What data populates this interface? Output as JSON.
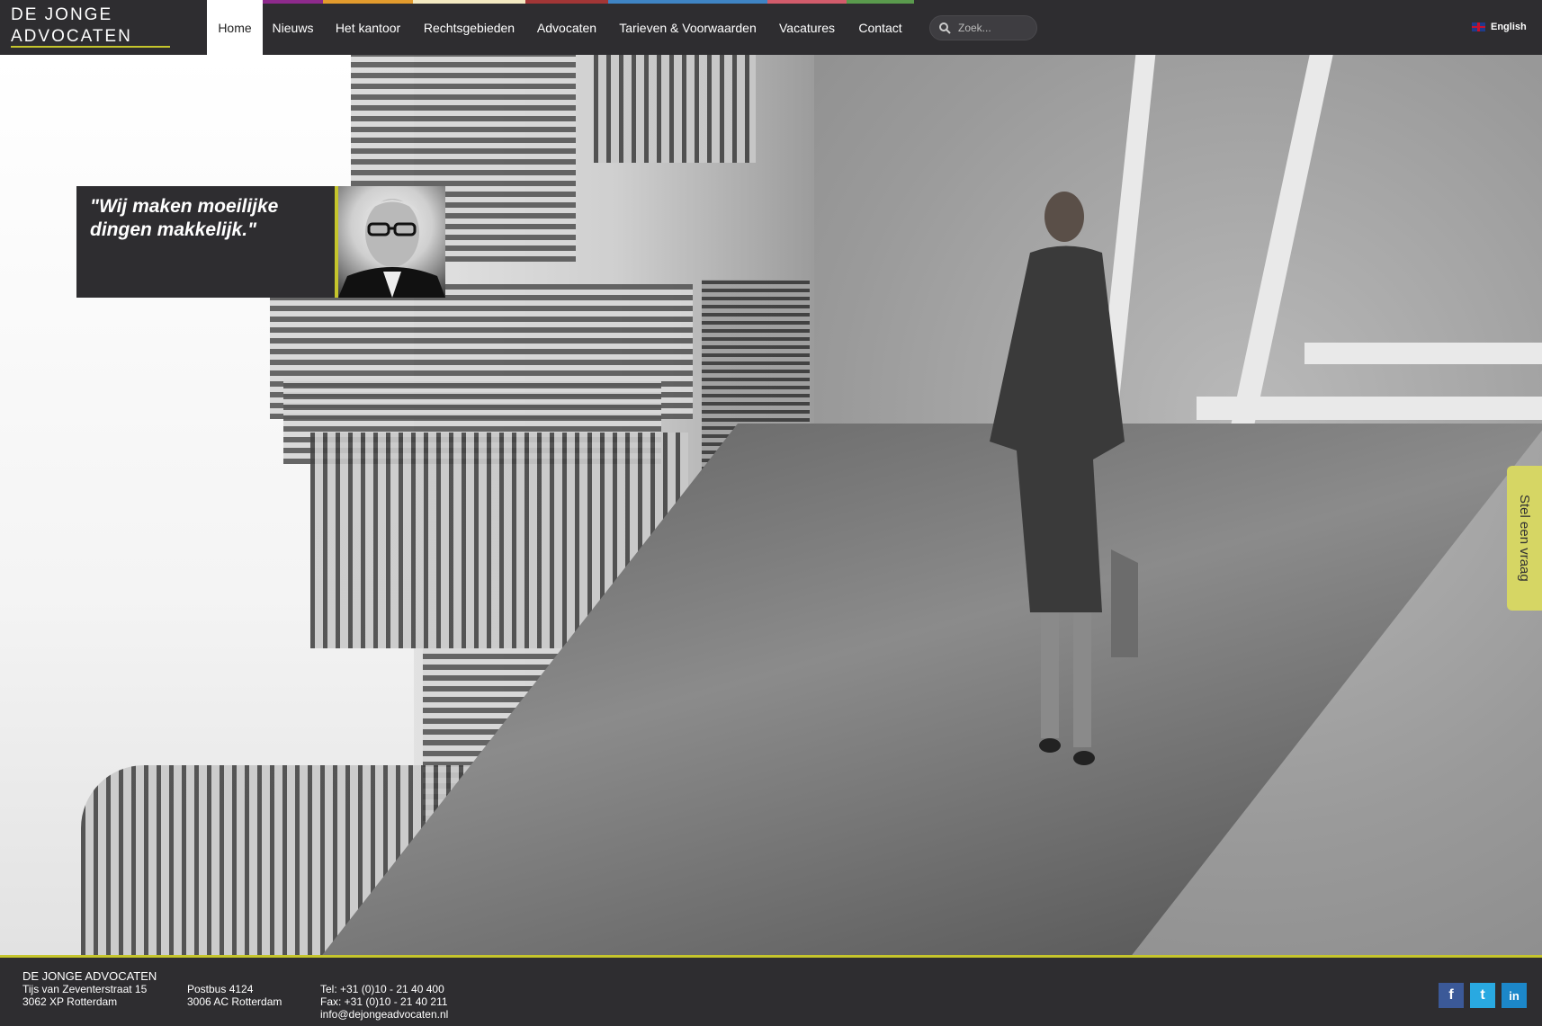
{
  "logo": {
    "line1": "DE JONGE",
    "line2": "ADVOCATEN"
  },
  "nav": [
    {
      "label": "Home",
      "color": "#ffffff"
    },
    {
      "label": "Nieuws",
      "color": "#8e2a8c"
    },
    {
      "label": "Het kantoor",
      "color": "#e39b2d"
    },
    {
      "label": "Rechtsgebieden",
      "color": "#f4eac2"
    },
    {
      "label": "Advocaten",
      "color": "#a23636"
    },
    {
      "label": "Tarieven & Voorwaarden",
      "color": "#3f84c4"
    },
    {
      "label": "Vacatures",
      "color": "#d25c6b"
    },
    {
      "label": "Contact",
      "color": "#5a9a4d"
    }
  ],
  "search": {
    "placeholder": "Zoek..."
  },
  "language": {
    "label": "English"
  },
  "hero": {
    "quote": "\"Wij maken moeilijke dingen makkelijk.\"",
    "ask_tab": "Stel een vraag"
  },
  "footer": {
    "company": "DE JONGE ADVOCATEN",
    "address1": "Tijs van Zeventerstraat 15",
    "address2": "3062 XP Rotterdam",
    "postbus1": "Postbus 4124",
    "postbus2": "3006 AC Rotterdam",
    "tel": "Tel: +31 (0)10 - 21 40 400",
    "fax": "Fax: +31 (0)10 - 21 40 211",
    "email": "info@dejongeadvocaten.nl"
  },
  "colors": {
    "accent": "#c5c52c",
    "dark": "#2e2d30",
    "ask_tab": "#d6d664"
  },
  "social": [
    {
      "icon": "facebook-icon",
      "glyph": "f",
      "color": "#3b5998"
    },
    {
      "icon": "twitter-icon",
      "glyph": "t",
      "color": "#29a9e1"
    },
    {
      "icon": "linkedin-icon",
      "glyph": "in",
      "color": "#1c87c9"
    }
  ]
}
